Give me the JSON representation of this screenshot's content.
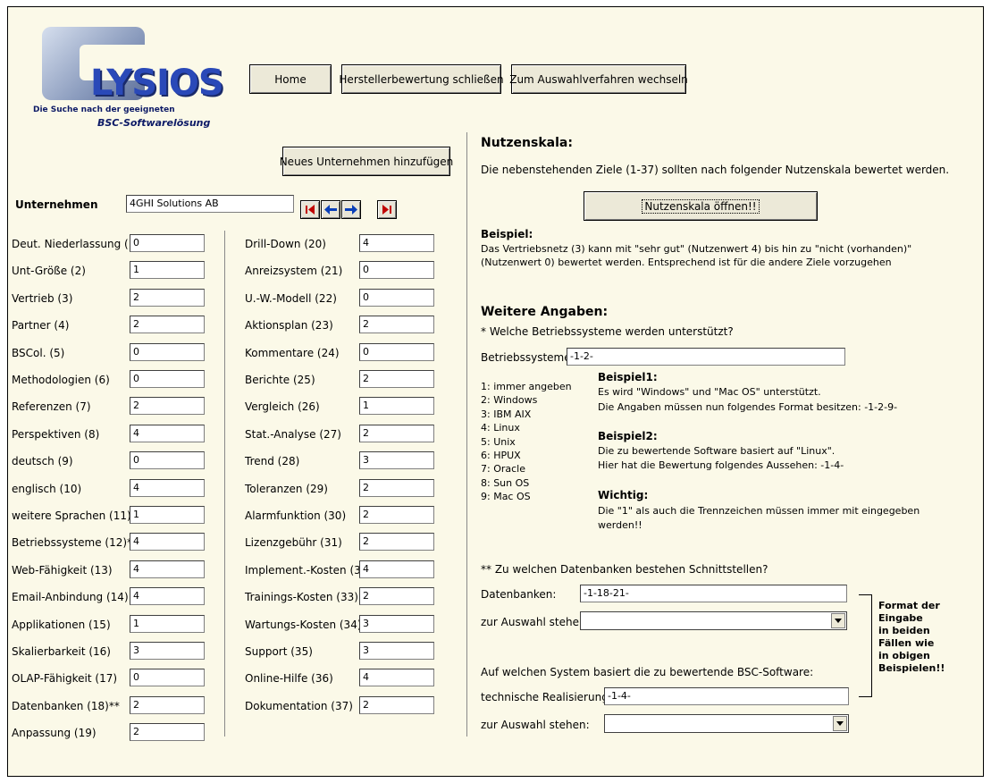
{
  "logo": {
    "text": "LYSIOS",
    "tagline1": "Die Suche nach der geeigneten",
    "tagline2": "BSC-Softwarelösung"
  },
  "toolbar": {
    "home": "Home",
    "close_rating": "Herstellerbewertung schließen",
    "switch": "Zum Auswahlverfahren wechseln"
  },
  "add_company": "Neues Unternehmen hinzufügen",
  "company": {
    "label": "Unternehmen",
    "value": "4GHI Solutions AB"
  },
  "criteria_left": [
    {
      "label": "Deut. Niederlassung (1)",
      "value": "0"
    },
    {
      "label": "Unt-Größe (2)",
      "value": "1"
    },
    {
      "label": "Vertrieb (3)",
      "value": "2"
    },
    {
      "label": "Partner (4)",
      "value": "2"
    },
    {
      "label": "BSCol. (5)",
      "value": "0"
    },
    {
      "label": "Methodologien (6)",
      "value": "0"
    },
    {
      "label": "Referenzen (7)",
      "value": "2"
    },
    {
      "label": "Perspektiven (8)",
      "value": "4"
    },
    {
      "label": "deutsch (9)",
      "value": "0"
    },
    {
      "label": "englisch (10)",
      "value": "4"
    },
    {
      "label": "weitere Sprachen (11)",
      "value": "1"
    },
    {
      "label": "Betriebssysteme (12)*",
      "value": "4"
    },
    {
      "label": "Web-Fähigkeit (13)",
      "value": "4"
    },
    {
      "label": "Email-Anbindung (14)",
      "value": "4"
    },
    {
      "label": "Applikationen (15)",
      "value": "1"
    },
    {
      "label": "Skalierbarkeit (16)",
      "value": "3"
    },
    {
      "label": "OLAP-Fähigkeit (17)",
      "value": "0"
    },
    {
      "label": "Datenbanken (18)**",
      "value": "2"
    },
    {
      "label": "Anpassung (19)",
      "value": "2"
    }
  ],
  "criteria_right": [
    {
      "label": "Drill-Down (20)",
      "value": "4"
    },
    {
      "label": "Anreizsystem (21)",
      "value": "0"
    },
    {
      "label": "U.-W.-Modell (22)",
      "value": "0"
    },
    {
      "label": "Aktionsplan (23)",
      "value": "2"
    },
    {
      "label": "Kommentare (24)",
      "value": "0"
    },
    {
      "label": "Berichte (25)",
      "value": "2"
    },
    {
      "label": "Vergleich (26)",
      "value": "1"
    },
    {
      "label": "Stat.-Analyse (27)",
      "value": "2"
    },
    {
      "label": "Trend (28)",
      "value": "3"
    },
    {
      "label": "Toleranzen (29)",
      "value": "2"
    },
    {
      "label": "Alarmfunktion (30)",
      "value": "2"
    },
    {
      "label": "Lizenzgebühr (31)",
      "value": "2"
    },
    {
      "label": "Implement.-Kosten (32)",
      "value": "4"
    },
    {
      "label": "Trainings-Kosten (33)",
      "value": "2"
    },
    {
      "label": "Wartungs-Kosten (34)",
      "value": "3"
    },
    {
      "label": "Support (35)",
      "value": "3"
    },
    {
      "label": "Online-Hilfe (36)",
      "value": "4"
    },
    {
      "label": "Dokumentation (37)",
      "value": "2"
    }
  ],
  "nutzen": {
    "title": "Nutzenskala:",
    "desc": "Die nebenstehenden Ziele (1-37) sollten nach folgender Nutzenskala bewertet werden.",
    "open_button": "Nutzenskala öffnen!!",
    "example_title": "Beispiel:",
    "example_line1": "Das Vertriebsnetz (3) kann mit \"sehr gut\" (Nutzenwert 4) bis hin zu \"nicht (vorhanden)\"",
    "example_line2": "(Nutzenwert 0) bewertet werden. Entsprechend ist für die andere Ziele vorzugehen"
  },
  "weitere": {
    "title": "Weitere Angaben:",
    "os_question": "* Welche Betriebssysteme werden unterstützt?",
    "os_label": "Betriebssysteme:",
    "os_value": "-1-2-",
    "os_list": [
      "1: immer angeben",
      "2: Windows",
      "3: IBM AIX",
      "4: Linux",
      "5: Unix",
      "6: HPUX",
      "7: Oracle",
      "8: Sun OS",
      "9: Mac OS"
    ],
    "bsp1_title": "Beispiel1:",
    "bsp1_line1": "Es wird \"Windows\" und \"Mac OS\" unterstützt.",
    "bsp1_line2": "Die Angaben müssen nun folgendes Format besitzen:  -1-2-9-",
    "bsp2_title": "Beispiel2:",
    "bsp2_line1": "Die zu bewertende Software basiert auf \"Linux\".",
    "bsp2_line2": "Hier hat die Bewertung folgendes Aussehen:   -1-4-",
    "wichtig_title": "Wichtig:",
    "wichtig_line1": "Die \"1\" als auch die Trennzeichen müssen immer mit eingegeben",
    "wichtig_line2": "werden!!",
    "db_question": "** Zu welchen Datenbanken bestehen Schnittstellen?",
    "db_label": "Datenbanken:",
    "db_value": "-1-18-21-",
    "choose_label": "zur Auswahl stehen:",
    "sys_question": "Auf welchen System basiert die zu bewertende BSC-Software:",
    "tech_label": "technische Realisierung:",
    "tech_value": "-1-4-",
    "choose_label2": "zur Auswahl stehen:",
    "format_note": [
      "Format der",
      "Eingabe",
      "in beiden",
      "Fällen wie",
      "in obigen",
      "Beispielen!!"
    ]
  }
}
